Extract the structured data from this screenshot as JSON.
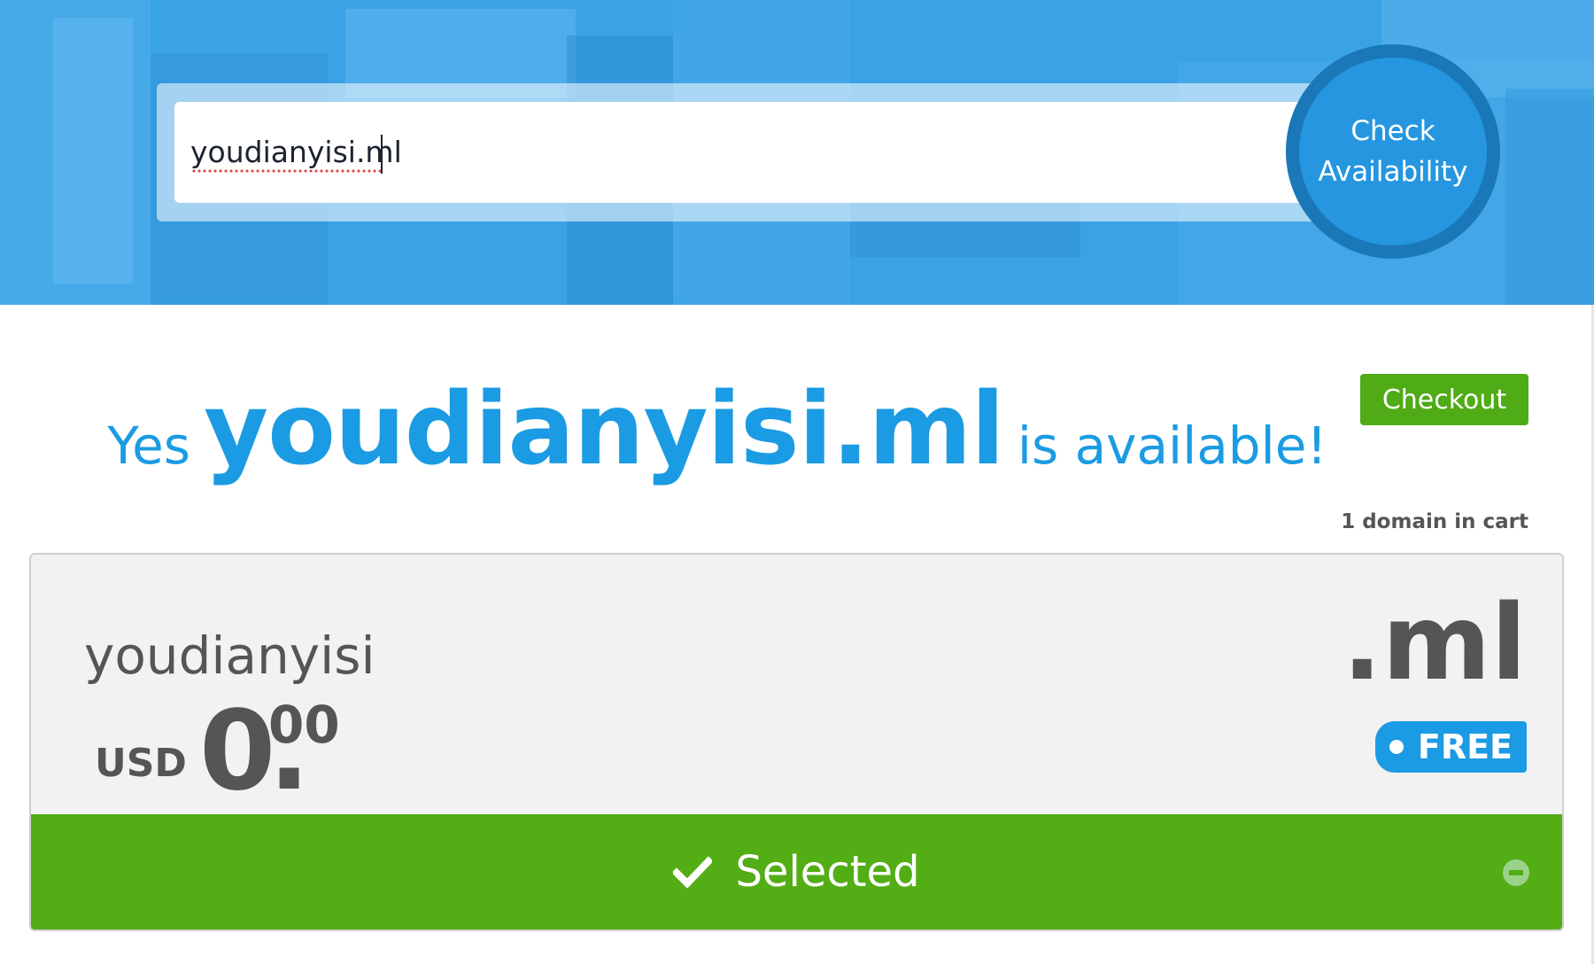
{
  "search": {
    "value": "youdianyisi.ml",
    "button_line1": "Check",
    "button_line2": "Availability"
  },
  "result": {
    "yes": "Yes",
    "domain": "youdianyisi.ml",
    "available": "is available!",
    "checkout_label": "Checkout",
    "cart_count": "1 domain in cart"
  },
  "card": {
    "name": "youdianyisi",
    "currency": "USD",
    "price_whole": "0",
    "price_dot": ".",
    "price_cents": "00",
    "tld": ".ml",
    "badge": "FREE",
    "selected_label": "Selected"
  },
  "colors": {
    "accent_blue": "#1b9be3",
    "success_green": "#53ad15",
    "checkout_green": "#4fab16",
    "text_gray": "#555555"
  },
  "icons": {
    "selected": "check-icon",
    "remove": "minus-circle-icon",
    "badge": "dot-icon"
  }
}
